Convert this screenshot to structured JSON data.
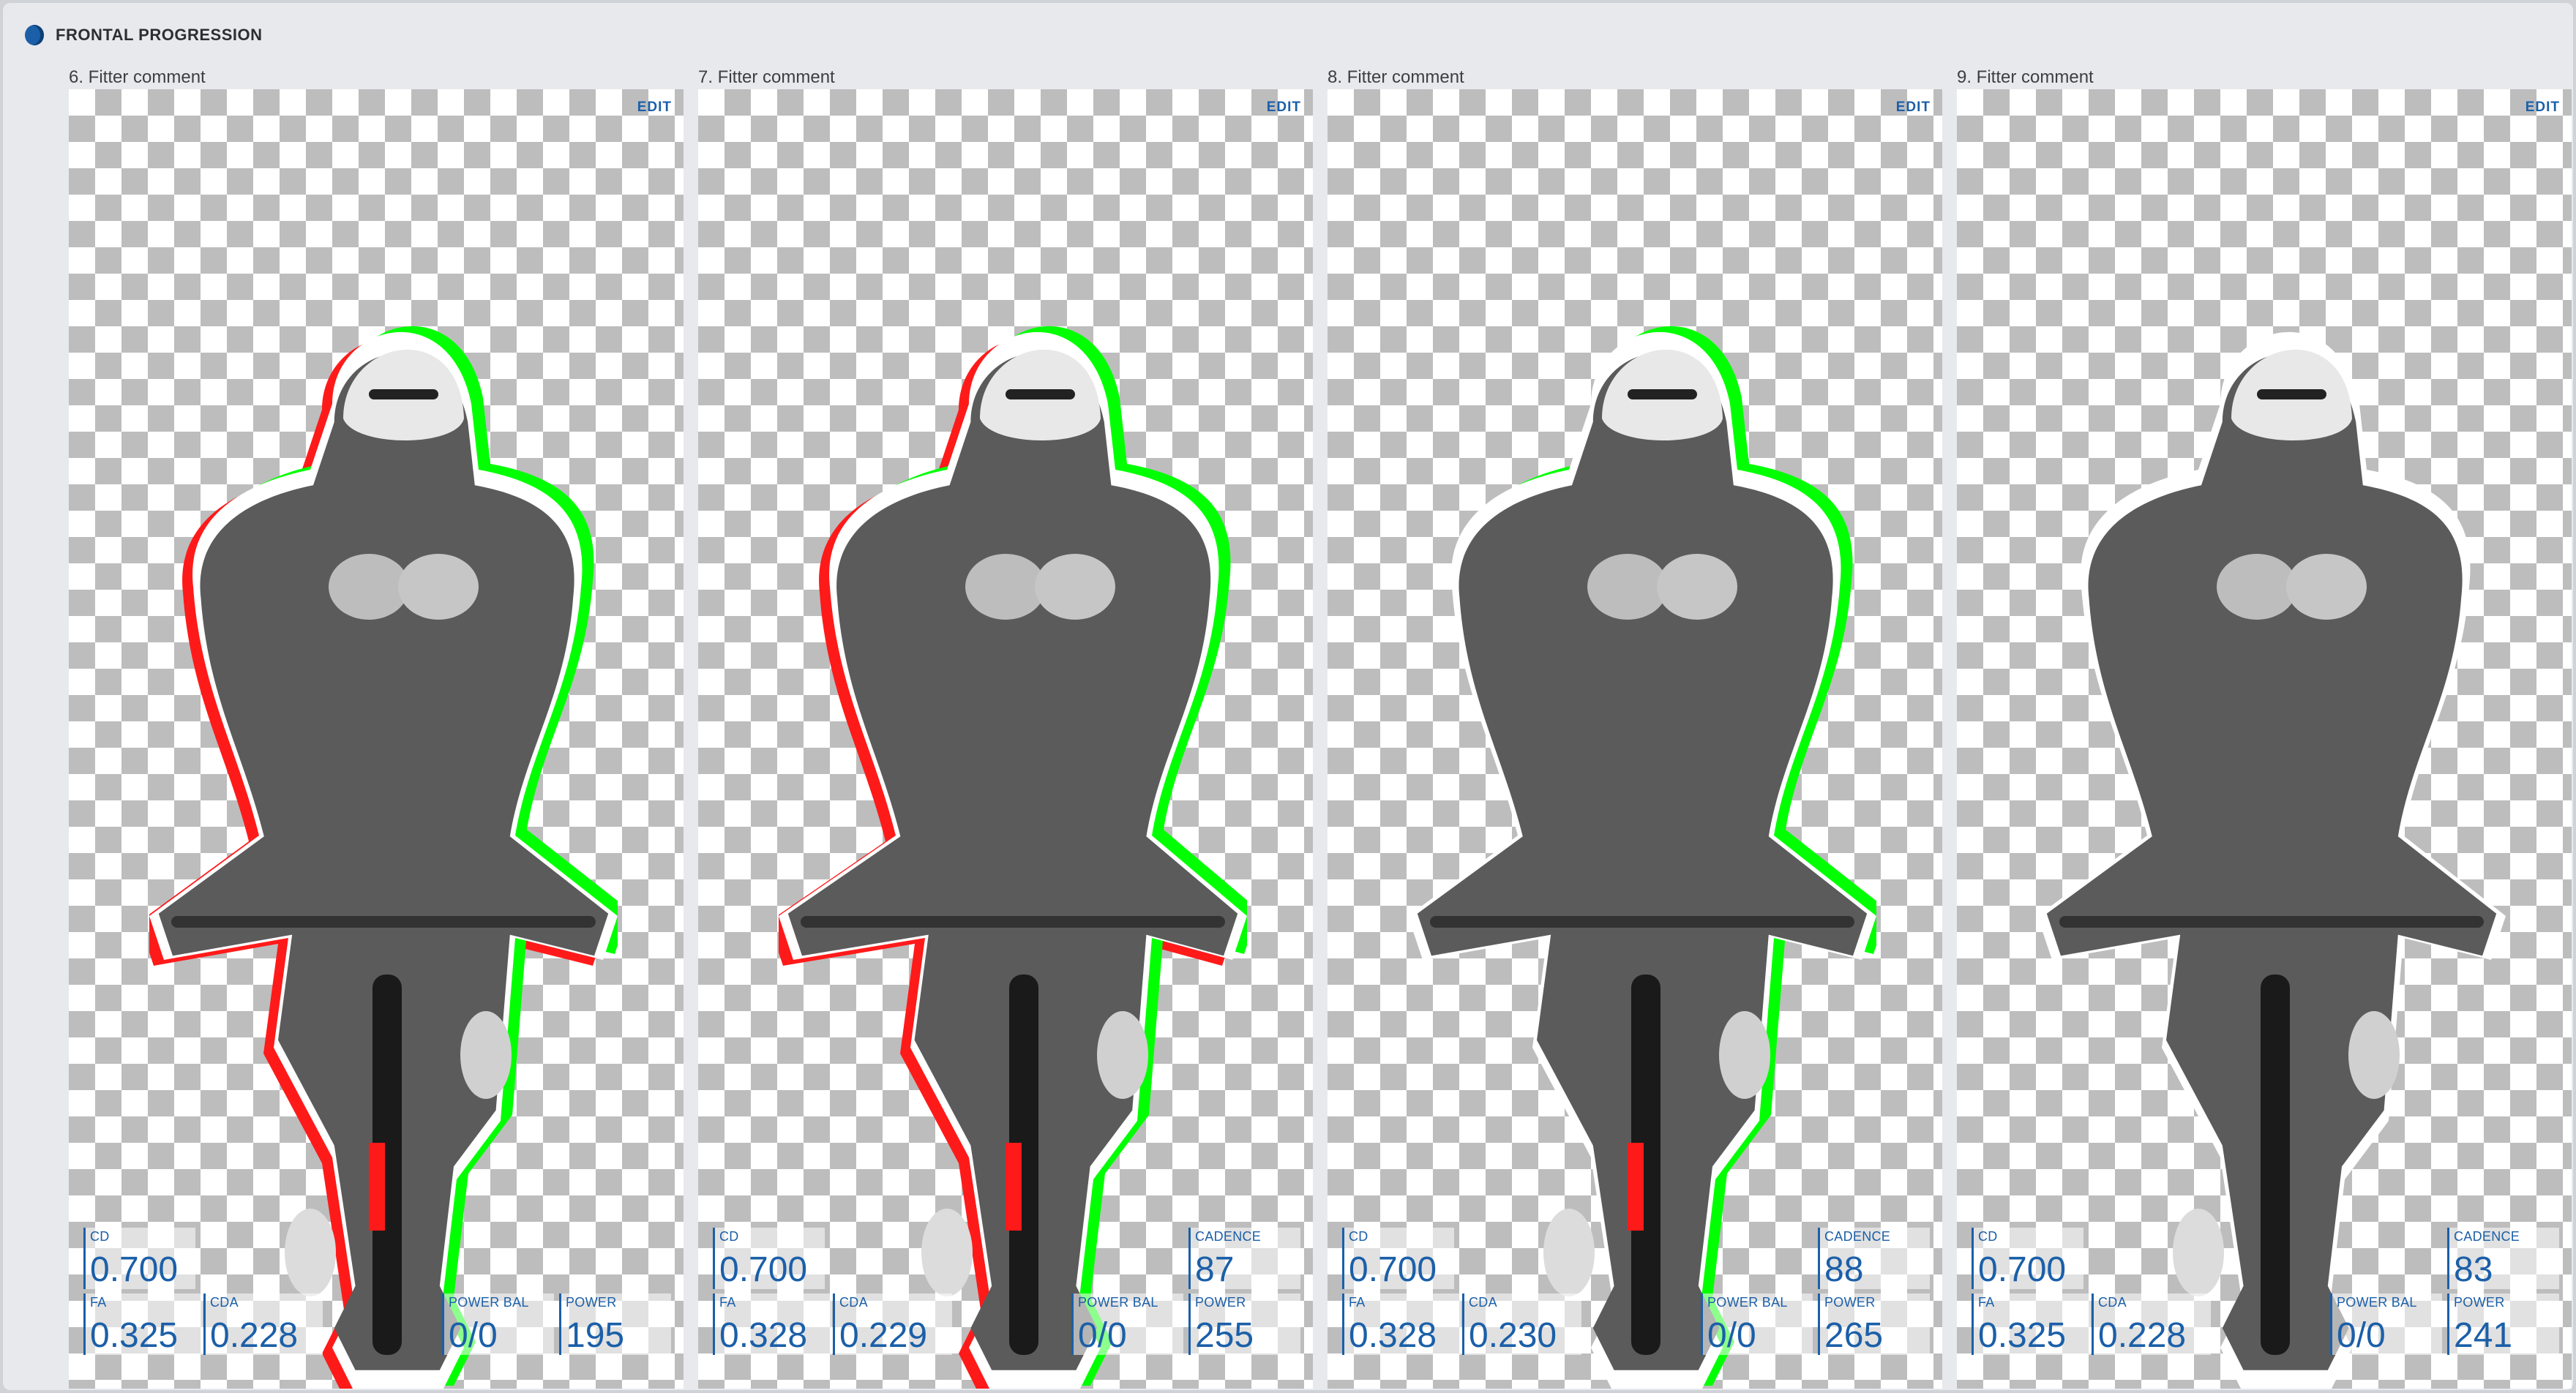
{
  "section": {
    "title": "FRONTAL PROGRESSION"
  },
  "panels": [
    {
      "title": "6. Fitter comment",
      "edit_label": "EDIT",
      "metrics": {
        "cd": {
          "label": "Cd",
          "value": "0.700"
        },
        "fa": {
          "label": "FA",
          "value": "0.325"
        },
        "cda": {
          "label": "CdA",
          "value": "0.228"
        },
        "power_bal": {
          "label": "POWER BAL",
          "value": "0/0"
        },
        "power": {
          "label": "POWER",
          "value": "195"
        }
      }
    },
    {
      "title": "7. Fitter comment",
      "edit_label": "EDIT",
      "metrics": {
        "cd": {
          "label": "Cd",
          "value": "0.700"
        },
        "cadence": {
          "label": "CADENCE",
          "value": "87"
        },
        "fa": {
          "label": "FA",
          "value": "0.328"
        },
        "cda": {
          "label": "CdA",
          "value": "0.229"
        },
        "power_bal": {
          "label": "POWER BAL",
          "value": "0/0"
        },
        "power": {
          "label": "POWER",
          "value": "255"
        }
      }
    },
    {
      "title": "8. Fitter comment",
      "edit_label": "EDIT",
      "metrics": {
        "cd": {
          "label": "Cd",
          "value": "0.700"
        },
        "cadence": {
          "label": "CADENCE",
          "value": "88"
        },
        "fa": {
          "label": "FA",
          "value": "0.328"
        },
        "cda": {
          "label": "CdA",
          "value": "0.230"
        },
        "power_bal": {
          "label": "POWER BAL",
          "value": "0/0"
        },
        "power": {
          "label": "POWER",
          "value": "265"
        }
      }
    },
    {
      "title": "9. Fitter comment",
      "edit_label": "EDIT",
      "metrics": {
        "cd": {
          "label": "Cd",
          "value": "0.700"
        },
        "cadence": {
          "label": "CADENCE",
          "value": "83"
        },
        "fa": {
          "label": "FA",
          "value": "0.325"
        },
        "cda": {
          "label": "CdA",
          "value": "0.228"
        },
        "power_bal": {
          "label": "POWER BAL",
          "value": "0/0"
        },
        "power": {
          "label": "POWER",
          "value": "241"
        }
      }
    }
  ],
  "colors": {
    "accent": "#1b5fa8",
    "overlay_ahead": "#00ff00",
    "overlay_behind": "#ff1a1a"
  },
  "icons": {
    "section": "shield-icon"
  }
}
